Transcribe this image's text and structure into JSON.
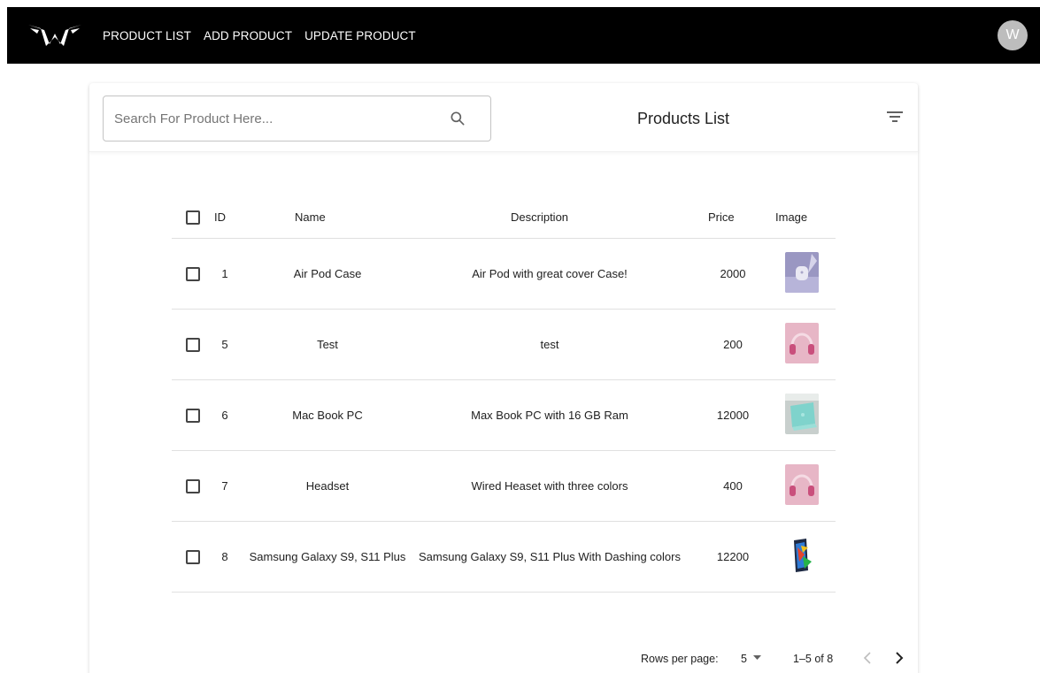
{
  "nav": {
    "logo_icon": "winged-w-logo-icon",
    "items": [
      {
        "label": "PRODUCT LIST"
      },
      {
        "label": "ADD PRODUCT"
      },
      {
        "label": "UPDATE PRODUCT"
      }
    ],
    "avatar_initial": "W"
  },
  "search": {
    "placeholder": "Search For Product Here...",
    "value": "",
    "icon": "search-icon"
  },
  "card": {
    "title": "Products List",
    "filter_icon": "filter-icon"
  },
  "table": {
    "columns": [
      "ID",
      "Name",
      "Description",
      "Price",
      "Image"
    ],
    "rows": [
      {
        "id": "1",
        "name": "Air Pod Case",
        "description": "Air Pod with great cover Case!",
        "price": "2000",
        "image": "airpod-case-thumbnail",
        "checked": false
      },
      {
        "id": "5",
        "name": "Test",
        "description": "test",
        "price": "200",
        "image": "pink-headset-thumbnail",
        "checked": false
      },
      {
        "id": "6",
        "name": "Mac Book PC",
        "description": "Max Book PC with 16 GB Ram",
        "price": "12000",
        "image": "macbook-thumbnail",
        "checked": false
      },
      {
        "id": "7",
        "name": "Headset",
        "description": "Wired Heaset with three colors",
        "price": "400",
        "image": "pink-headset-thumbnail",
        "checked": false
      },
      {
        "id": "8",
        "name": "Samsung Galaxy S9, S11 Plus",
        "description": "Samsung Galaxy S9, S11 Plus With Dashing colors",
        "price": "12200",
        "image": "samsung-phone-thumbnail",
        "checked": false
      }
    ]
  },
  "pagination": {
    "rows_per_page_label": "Rows per page:",
    "rows_per_page_value": "5",
    "range": "1–5 of 8",
    "prev_icon": "chevron-left-icon",
    "next_icon": "chevron-right-icon"
  },
  "colors": {
    "appbar": "#000000",
    "avatar": "#bdbdbd",
    "divider": "#e0e0e0"
  }
}
